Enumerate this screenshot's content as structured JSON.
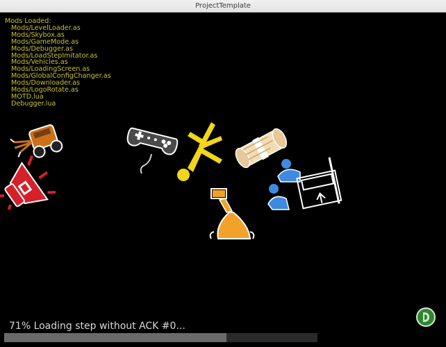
{
  "window": {
    "title": "ProjectTemplate"
  },
  "mods": {
    "header": "Mods Loaded:",
    "items": [
      "Mods/LevelLoader.as",
      "Mods/Skybox.as",
      "Mods/GameMode.as",
      "Mods/Debugger.as",
      "Mods/LoadStepImitator.as",
      "Mods/Vehicles.as",
      "Mods/LoadingScreen.as",
      "Mods/GlobalConfigChanger.as",
      "Mods/Downloader.as",
      "Mods/LogoRotate.as",
      "MOTD.lua",
      "Debugger.lua"
    ]
  },
  "loading": {
    "status": "71% Loading step without ACK #0...",
    "progress_fraction": 0.71
  },
  "icons": {
    "scattered": [
      "vehicle-icon",
      "megaphone-icon",
      "gamepad-icon",
      "falling-person-icon",
      "scroll-icon",
      "users-computer-icon",
      "lamp-icon"
    ],
    "logo": "engine-logo-icon"
  },
  "colors": {
    "mod_text": "#c9c13a",
    "status_text": "#d8d8d8",
    "progress_fill": "#6a6a6a",
    "background": "#000000"
  }
}
